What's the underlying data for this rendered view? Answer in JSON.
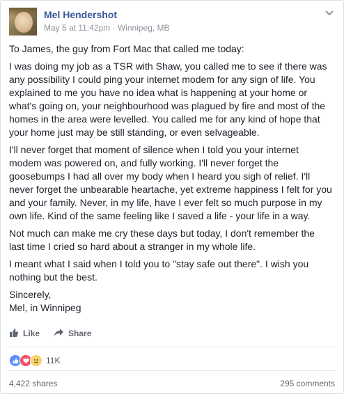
{
  "post": {
    "author": "Mel Hendershot",
    "date": "May 5 at 11:42pm",
    "separator": "·",
    "location": "Winnipeg, MB",
    "paragraphs": [
      "To James, the guy from Fort Mac that called me today:",
      "I was doing my job as a TSR with Shaw, you called me to see if there was any possibility I could ping your internet modem for any sign of life. You explained to me you have no idea what is happening at your home or what's going on, your neighbourhood was plagued by fire and most of the homes in the area were levelled. You called me for any kind of hope that your home just may be still standing, or even selvageable.",
      "I'll never forget that moment of silence when I told you your internet modem was powered on, and fully working. I'll never forget the goosebumps I had all over my body when I heard you sigh of relief. I'll never forget the unbearable heartache, yet extreme happiness I felt for you and your family. Never, in my life, have I ever felt so much purpose in my own life. Kind of the same feeling like I saved a life - your life in a way.",
      "Not much can make me cry these days but today, I don't remember the last time I cried so hard about a stranger in my whole life.",
      "I meant what I said when I told you to \"stay safe out there\". I wish you nothing but the best.",
      "Sincerely,\nMel, in Winnipeg"
    ]
  },
  "actions": {
    "like_label": "Like",
    "share_label": "Share"
  },
  "reactions": {
    "count": "11K",
    "icons": [
      "like-icon",
      "love-icon",
      "sad-icon"
    ],
    "colors": {
      "like": "#5890ff",
      "love": "#f25268",
      "sad": "#f7d46d"
    }
  },
  "footer": {
    "shares": "4,422 shares",
    "comments": "295 comments"
  },
  "colors": {
    "author_link": "#365899",
    "meta": "#90949c",
    "body_text": "#1d2129"
  }
}
